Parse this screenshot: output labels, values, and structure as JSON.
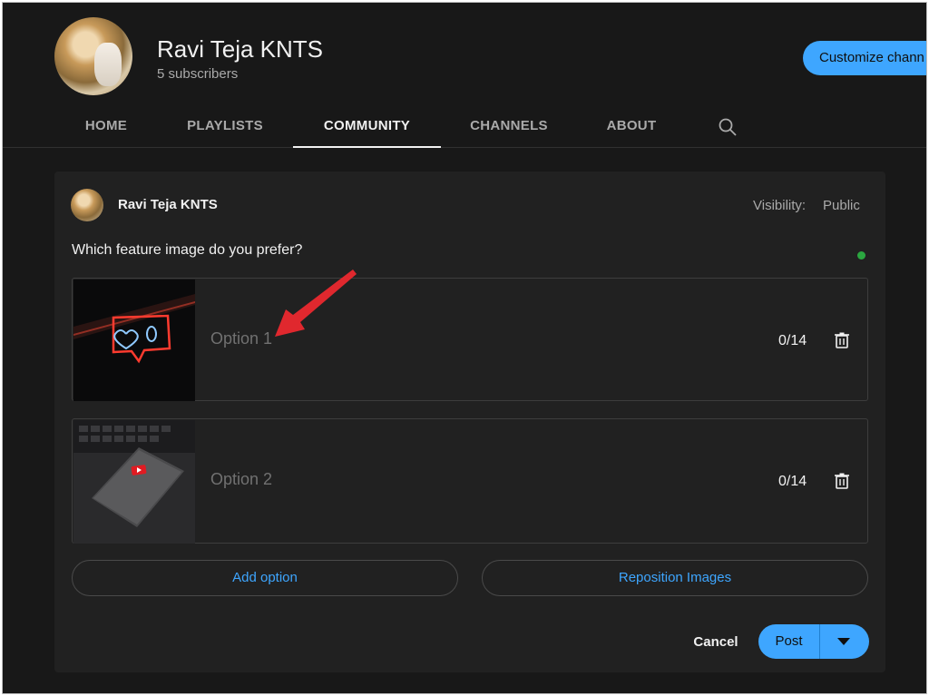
{
  "header": {
    "channel_name": "Ravi Teja KNTS",
    "subscribers": "5 subscribers",
    "customize_label": "Customize chann"
  },
  "tabs": [
    {
      "label": "HOME",
      "active": false
    },
    {
      "label": "PLAYLISTS",
      "active": false
    },
    {
      "label": "COMMUNITY",
      "active": true
    },
    {
      "label": "CHANNELS",
      "active": false
    },
    {
      "label": "ABOUT",
      "active": false
    }
  ],
  "post": {
    "author": "Ravi Teja KNTS",
    "visibility_label": "Visibility:",
    "visibility_value": "Public",
    "question": "Which feature image do you prefer?",
    "options": [
      {
        "placeholder": "Option 1",
        "count": "0/14",
        "image": "neon-heart-sign"
      },
      {
        "placeholder": "Option 2",
        "count": "0/14",
        "image": "phone-youtube-logo"
      }
    ],
    "add_option_label": "Add option",
    "reposition_label": "Reposition Images",
    "cancel_label": "Cancel",
    "post_label": "Post"
  },
  "colors": {
    "background": "#181818",
    "card": "#212121",
    "accent": "#3ea6ff",
    "annotation_arrow": "#e0282e"
  }
}
